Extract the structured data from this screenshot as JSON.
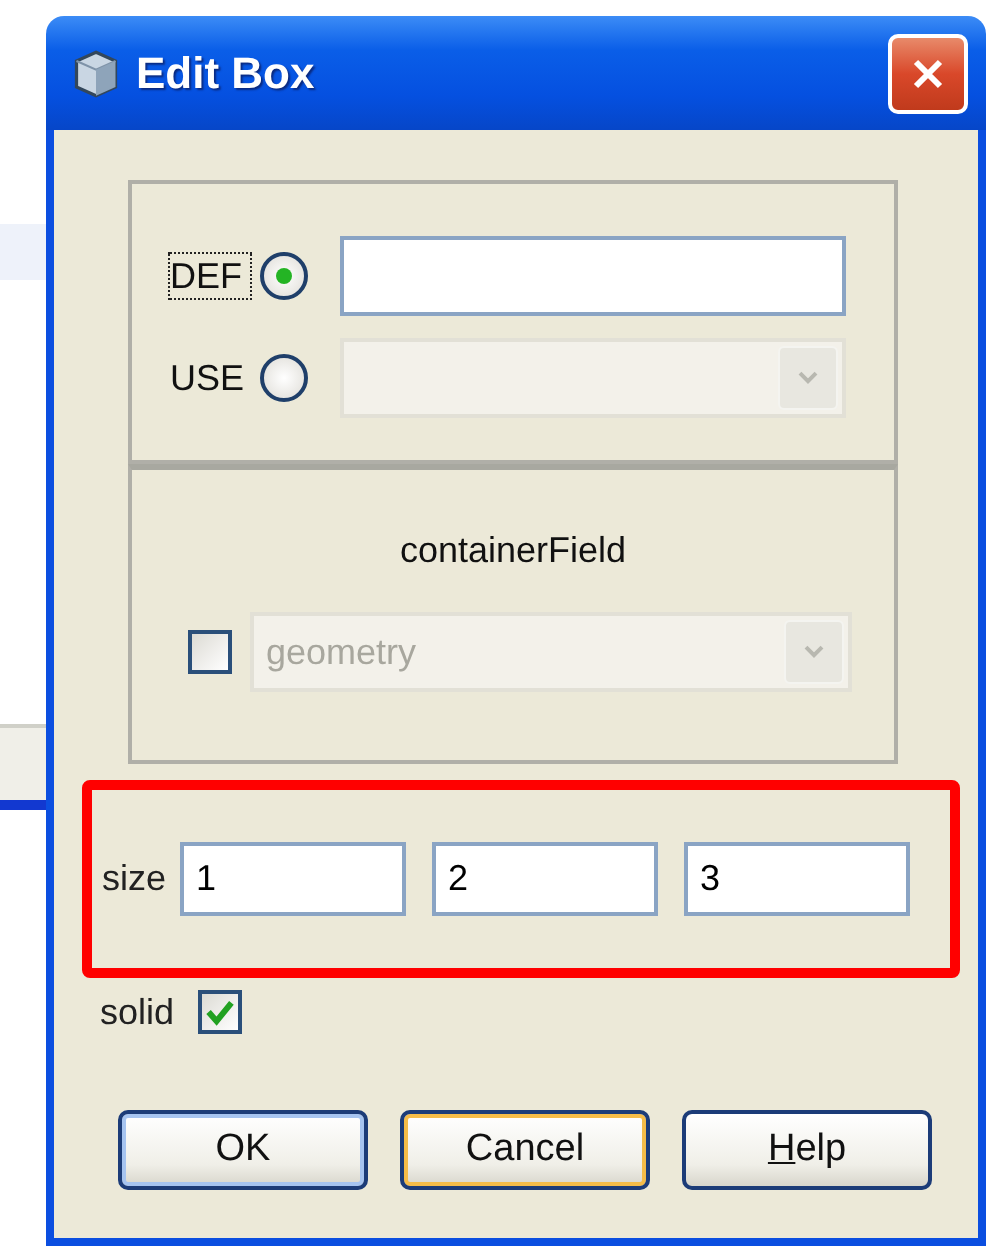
{
  "window": {
    "title": "Edit Box"
  },
  "reference_options": [
    {
      "label": "DEF",
      "selected": true,
      "focused": true,
      "kind": "text",
      "disabled": false
    },
    {
      "label": "USE",
      "selected": false,
      "focused": false,
      "kind": "dropdown",
      "disabled": true
    }
  ],
  "container_field": {
    "title": "containerField",
    "checked": false,
    "value": "geometry",
    "disabled": true
  },
  "size": {
    "label": "size",
    "highlighted": true,
    "values": [
      "1",
      "2",
      "3"
    ]
  },
  "solid": {
    "label": "solid",
    "checked": true
  },
  "buttons": [
    {
      "label": "OK",
      "kind": "default",
      "mnemonic_underlined": false
    },
    {
      "label": "Cancel",
      "kind": "focused",
      "mnemonic_underlined": false
    },
    {
      "label": "Help",
      "kind": "normal",
      "mnemonic_underlined": true
    }
  ]
}
